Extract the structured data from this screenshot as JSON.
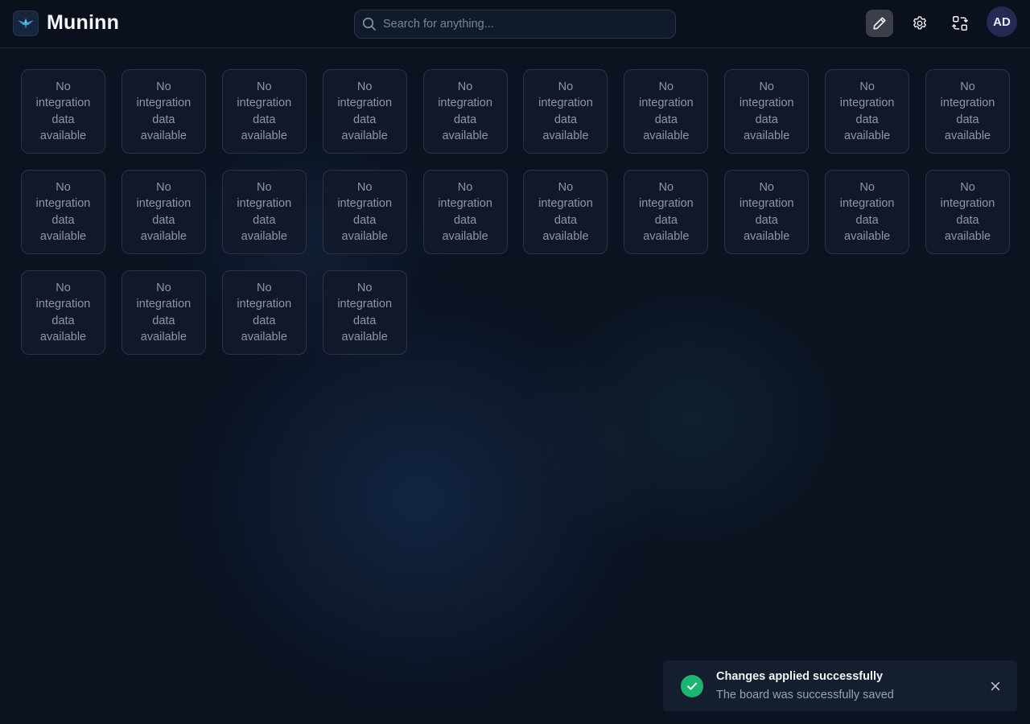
{
  "app": {
    "brand": "Muninn"
  },
  "search": {
    "placeholder": "Search for anything..."
  },
  "header": {
    "buttons": [
      {
        "name": "edit-mode",
        "icon": "pencil-icon",
        "active": true
      },
      {
        "name": "settings",
        "icon": "gear-icon",
        "active": false
      },
      {
        "name": "switch-board",
        "icon": "swap-layout-icon",
        "active": false
      }
    ],
    "avatar_initials": "AD"
  },
  "widgets": [
    "No integration data available",
    "No integration data available",
    "No integration data available",
    "No integration data available",
    "No integration data available",
    "No integration data available",
    "No integration data available",
    "No integration data available",
    "No integration data available",
    "No integration data available",
    "No integration data available",
    "No integration data available",
    "No integration data available",
    "No integration data available",
    "No integration data available",
    "No integration data available",
    "No integration data available",
    "No integration data available",
    "No integration data available",
    "No integration data available",
    "No integration data available",
    "No integration data available",
    "No integration data available",
    "No integration data available"
  ],
  "toast": {
    "title": "Changes applied successfully",
    "message": "The board was successfully saved",
    "status_color": "#1db46f"
  }
}
